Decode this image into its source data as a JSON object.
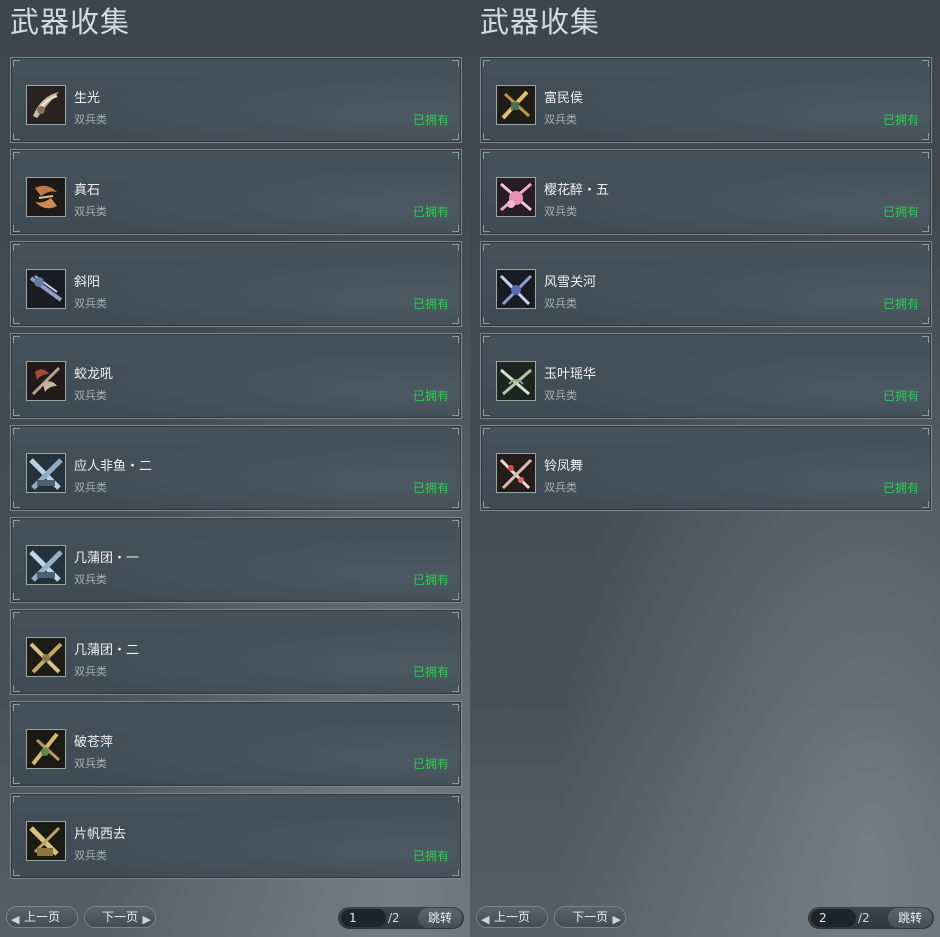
{
  "colors": {
    "owned_green": "#2ecc52",
    "card_border": "#7d878f",
    "name_text": "#eef0f1",
    "type_text": "#a8b0b5"
  },
  "panels": [
    {
      "title": "武器收集",
      "items": [
        {
          "name": "生光",
          "type": "双兵类",
          "status": "已拥有",
          "icon": "weapon-thumbnail-icon"
        },
        {
          "name": "真石",
          "type": "双兵类",
          "status": "已拥有",
          "icon": "weapon-thumbnail-icon"
        },
        {
          "name": "斜阳",
          "type": "双兵类",
          "status": "已拥有",
          "icon": "weapon-thumbnail-icon"
        },
        {
          "name": "蛟龙吼",
          "type": "双兵类",
          "status": "已拥有",
          "icon": "weapon-thumbnail-icon"
        },
        {
          "name": "应人非鱼・二",
          "type": "双兵类",
          "status": "已拥有",
          "icon": "weapon-thumbnail-icon"
        },
        {
          "name": "几蒲团・一",
          "type": "双兵类",
          "status": "已拥有",
          "icon": "weapon-thumbnail-icon"
        },
        {
          "name": "几蒲团・二",
          "type": "双兵类",
          "status": "已拥有",
          "icon": "weapon-thumbnail-icon"
        },
        {
          "name": "破苍萍",
          "type": "双兵类",
          "status": "已拥有",
          "icon": "weapon-thumbnail-icon"
        },
        {
          "name": "片帆西去",
          "type": "双兵类",
          "status": "已拥有",
          "icon": "weapon-thumbnail-icon"
        }
      ],
      "pager": {
        "prev_label": "上一页",
        "next_label": "下一页",
        "current_page": "1",
        "total": "/2",
        "jump_label": "跳转"
      }
    },
    {
      "title": "武器收集",
      "items": [
        {
          "name": "富民侯",
          "type": "双兵类",
          "status": "已拥有",
          "icon": "weapon-thumbnail-icon"
        },
        {
          "name": "樱花醉・五",
          "type": "双兵类",
          "status": "已拥有",
          "icon": "weapon-thumbnail-icon"
        },
        {
          "name": "风雪关河",
          "type": "双兵类",
          "status": "已拥有",
          "icon": "weapon-thumbnail-icon"
        },
        {
          "name": "玉叶瑶华",
          "type": "双兵类",
          "status": "已拥有",
          "icon": "weapon-thumbnail-icon"
        },
        {
          "name": "铃凤舞",
          "type": "双兵类",
          "status": "已拥有",
          "icon": "weapon-thumbnail-icon"
        }
      ],
      "pager": {
        "prev_label": "上一页",
        "next_label": "下一页",
        "current_page": "2",
        "total": "/2",
        "jump_label": "跳转"
      }
    }
  ]
}
